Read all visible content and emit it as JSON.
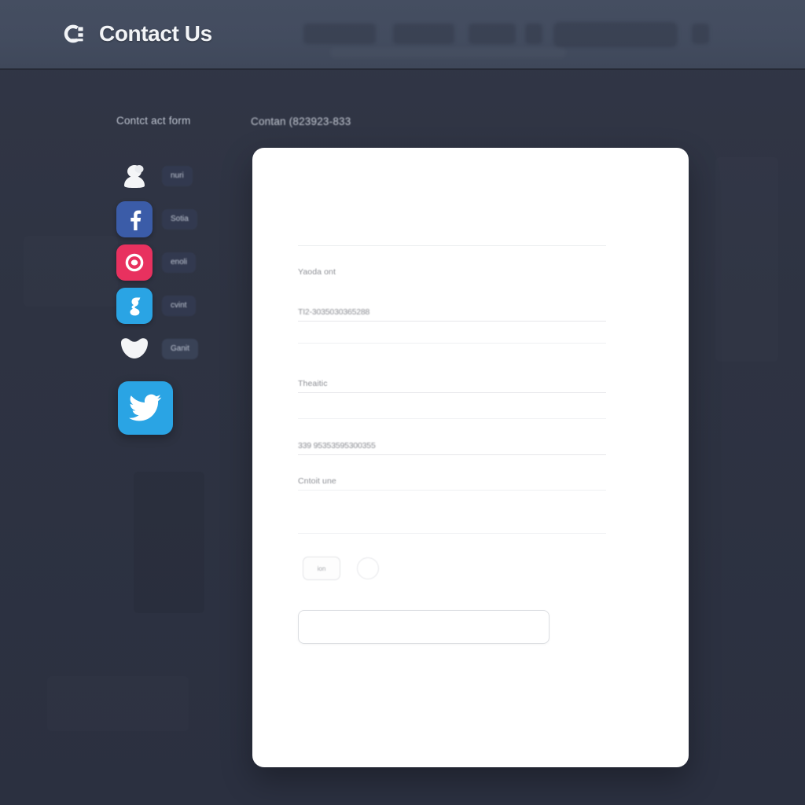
{
  "header": {
    "logo_icon": "c-logo-icon",
    "title": "Contact Us",
    "ghost_nav": [
      {
        "label": ""
      },
      {
        "label": ""
      },
      {
        "label": ""
      },
      {
        "label": ""
      }
    ],
    "search": {
      "placeholder": ""
    }
  },
  "colors": {
    "page_bg": "#2f3444",
    "header_bg": "#434c5f",
    "card_bg": "#ffffff",
    "facebook": "#3b5ca8",
    "instagram": "#e8315f",
    "telegram": "#2aa4e4",
    "twitter": "#2aa4e4",
    "badge_bg": "#333a50"
  },
  "sidebar": {
    "heading": "Contct act form",
    "items": [
      {
        "icon": "blob-avatar-icon",
        "badge": "nuri",
        "tile_color": "transparent"
      },
      {
        "icon": "facebook-icon",
        "badge": "Sotia",
        "tile_color": "#3b5ca8"
      },
      {
        "icon": "instagram-icon",
        "badge": "enoli",
        "tile_color": "#e8315f"
      },
      {
        "icon": "telegram-icon",
        "badge": "cvint",
        "tile_color": "#2aa4e4"
      },
      {
        "icon": "heart-blob-icon",
        "badge": "Ganit",
        "tile_color": "transparent"
      }
    ],
    "feature_icon": {
      "icon": "twitter-icon",
      "tile_color": "#2aa4e4"
    }
  },
  "form": {
    "heading": "Contan (823923-833",
    "fields": [
      {
        "label": "Yaoda ont",
        "value": ""
      },
      {
        "label": "",
        "value": "TI2-3035030365288"
      },
      {
        "label": "Theaitic",
        "value": ""
      },
      {
        "label": "",
        "value": "339 95353595300355"
      },
      {
        "label": "Cntoit une",
        "value": ""
      }
    ],
    "small_button": {
      "label": "ion"
    },
    "circle_control": {
      "label": ""
    },
    "wide_input": {
      "value": "",
      "placeholder": ""
    }
  }
}
